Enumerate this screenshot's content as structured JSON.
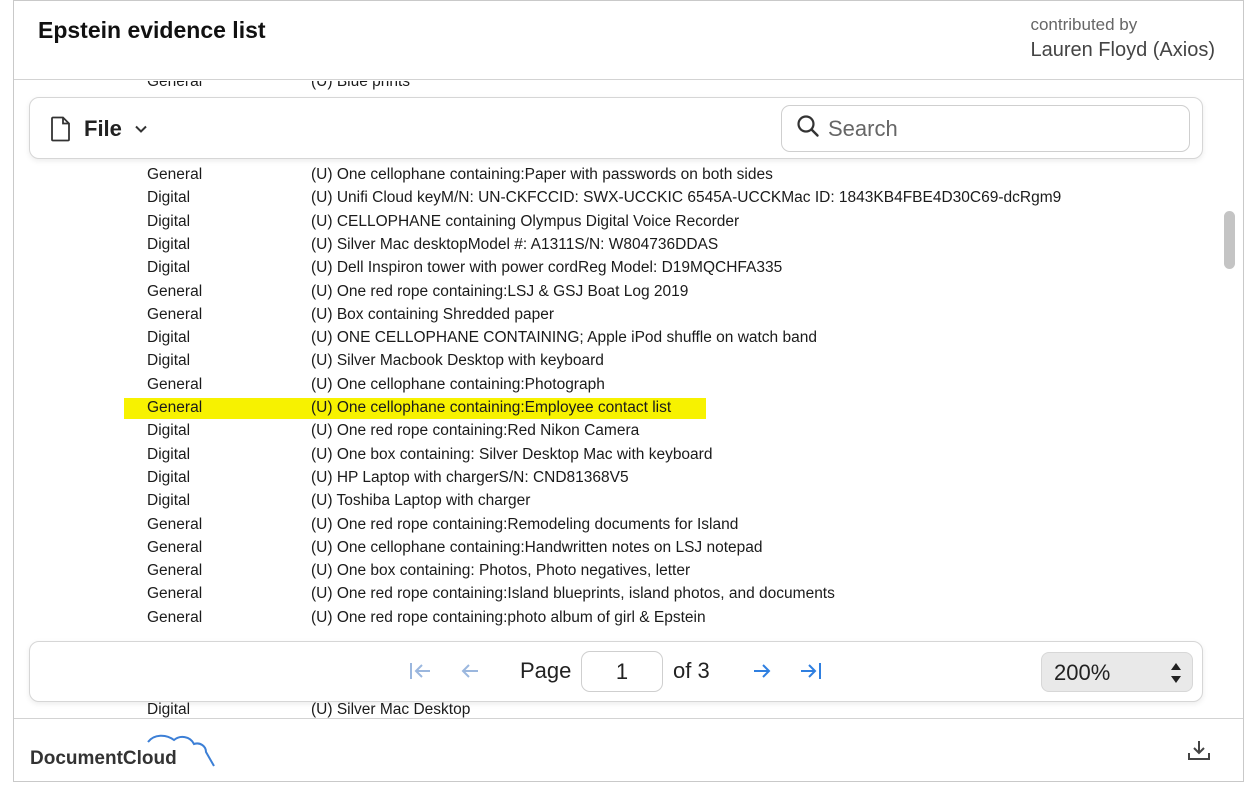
{
  "header": {
    "title": "Epstein evidence list",
    "contributed_label": "contributed by",
    "contributor": "Lauren Floyd (Axios)"
  },
  "toolbar": {
    "file_label": "File",
    "search_placeholder": "Search"
  },
  "document": {
    "top_partial_row": {
      "category": "General",
      "description": "(U) Blue prints"
    },
    "rows": [
      {
        "category": "General",
        "description": "(U) One cellophane containing:Paper with passwords on both sides"
      },
      {
        "category": "Digital",
        "description": "(U) Unifi Cloud keyM/N: UN-CKFCCID: SWX-UCCKIC 6545A-UCCKMac ID: 1843KB4FBE4D30C69-dcRgm9"
      },
      {
        "category": "Digital",
        "description": "(U) CELLOPHANE containing Olympus Digital Voice Recorder"
      },
      {
        "category": "Digital",
        "description": "(U) Silver Mac desktopModel #: A1311S/N: W804736DDAS"
      },
      {
        "category": "Digital",
        "description": "(U) Dell Inspiron tower with power cordReg Model: D19MQCHFA335"
      },
      {
        "category": "General",
        "description": "(U) One red rope containing:LSJ & GSJ Boat Log 2019"
      },
      {
        "category": "General",
        "description": "(U) Box containing Shredded paper"
      },
      {
        "category": "Digital",
        "description": "(U) ONE CELLOPHANE CONTAINING; Apple iPod shuffle on watch band"
      },
      {
        "category": "Digital",
        "description": "(U) Silver Macbook Desktop with keyboard"
      },
      {
        "category": "General",
        "description": "(U) One cellophane containing:Photograph"
      },
      {
        "category": "General",
        "description": "(U) One cellophane containing:Employee contact list",
        "highlighted": true
      },
      {
        "category": "Digital",
        "description": "(U) One red rope containing:Red Nikon Camera"
      },
      {
        "category": "Digital",
        "description": "(U) One box containing: Silver Desktop Mac with keyboard"
      },
      {
        "category": "Digital",
        "description": "(U) HP Laptop with chargerS/N: CND81368V5"
      },
      {
        "category": "Digital",
        "description": "(U) Toshiba Laptop with charger"
      },
      {
        "category": "General",
        "description": "(U) One red rope containing:Remodeling documents for Island"
      },
      {
        "category": "General",
        "description": "(U) One cellophane containing:Handwritten notes on LSJ notepad"
      },
      {
        "category": "General",
        "description": "(U) One box containing: Photos, Photo negatives, letter"
      },
      {
        "category": "General",
        "description": "(U) One red rope containing:Island blueprints, island photos, and documents"
      },
      {
        "category": "General",
        "description": "(U) One red rope containing:photo album of girl & Epstein"
      }
    ],
    "bottom_row": {
      "category": "Digital",
      "description": "(U) Silver Mac Desktop"
    }
  },
  "pager": {
    "page_label": "Page",
    "current_page": "1",
    "of_label": "of 3",
    "zoom": "200%"
  },
  "footer": {
    "brand": "DocumentCloud"
  },
  "colors": {
    "highlight": "#f7f200",
    "accent": "#2f7fe0",
    "brand_cloud": "#3c7fd6"
  }
}
